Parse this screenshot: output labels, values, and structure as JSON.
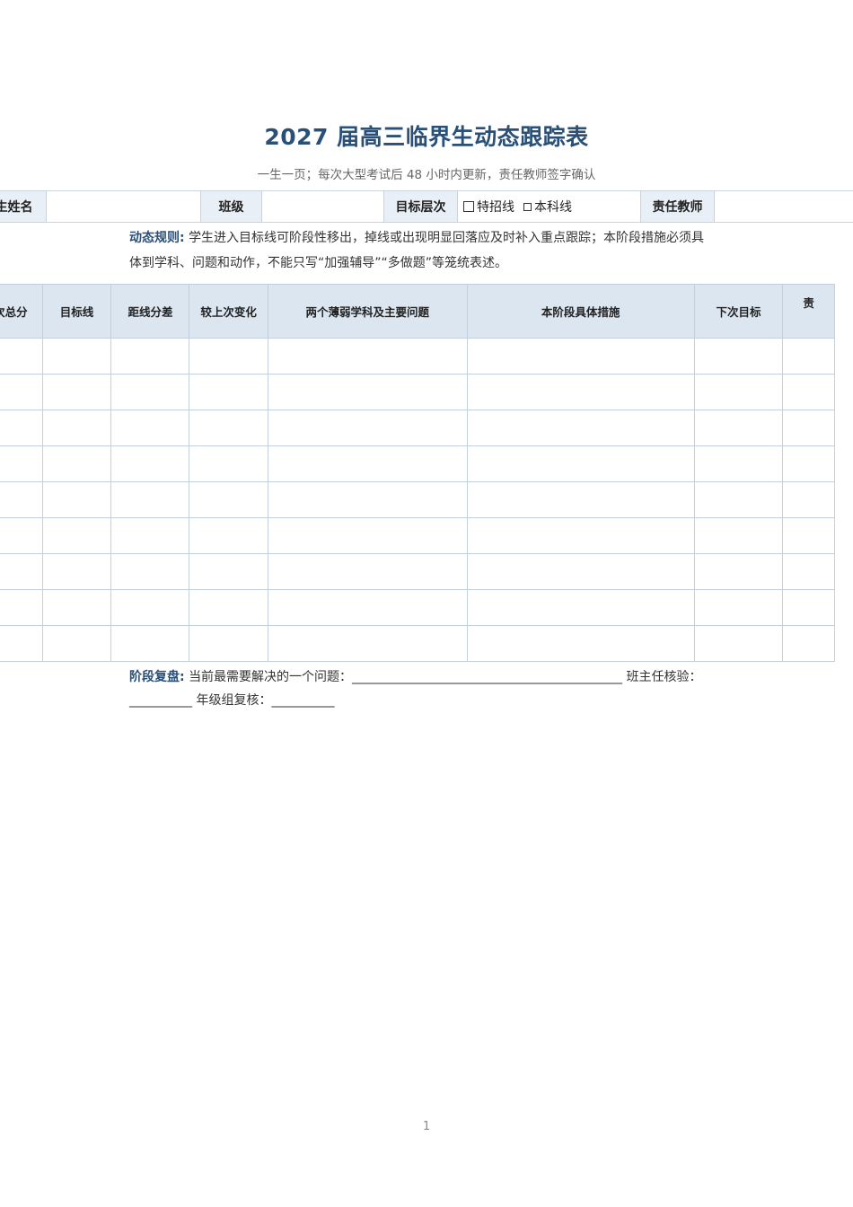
{
  "title": "2027 届高三临界生动态跟踪表",
  "subtitle": "一生一页；每次大型考试后 48 小时内更新，责任教师签字确认",
  "info": {
    "student_label": "生姓名",
    "class_label": "班级",
    "target_label": "目标层次",
    "option1": "特招线",
    "option2": "本科线",
    "teacher_label": "责任教师"
  },
  "rule": {
    "key": "动态规则:",
    "line1": "学生进入目标线可阶段性移出，掉线或出现明显回落应及时补入重点跟踪；本阶段措施必须具",
    "line2": "体到学科、问题和动作，不能只写“加强辅导”“多做题”等笼统表述。"
  },
  "table": {
    "headers": [
      "次总分",
      "目标线",
      "距线分差",
      "较上次变化",
      "两个薄弱学科及主要问题",
      "本阶段具体措施",
      "下次目标",
      "责"
    ],
    "row_count": 9
  },
  "review": {
    "key": "阶段复盘:",
    "line1": "当前最需要解决的一个问题：___________________________________________   班主任核验：",
    "line2": "__________   年级组复核：__________"
  },
  "page_number": "1"
}
